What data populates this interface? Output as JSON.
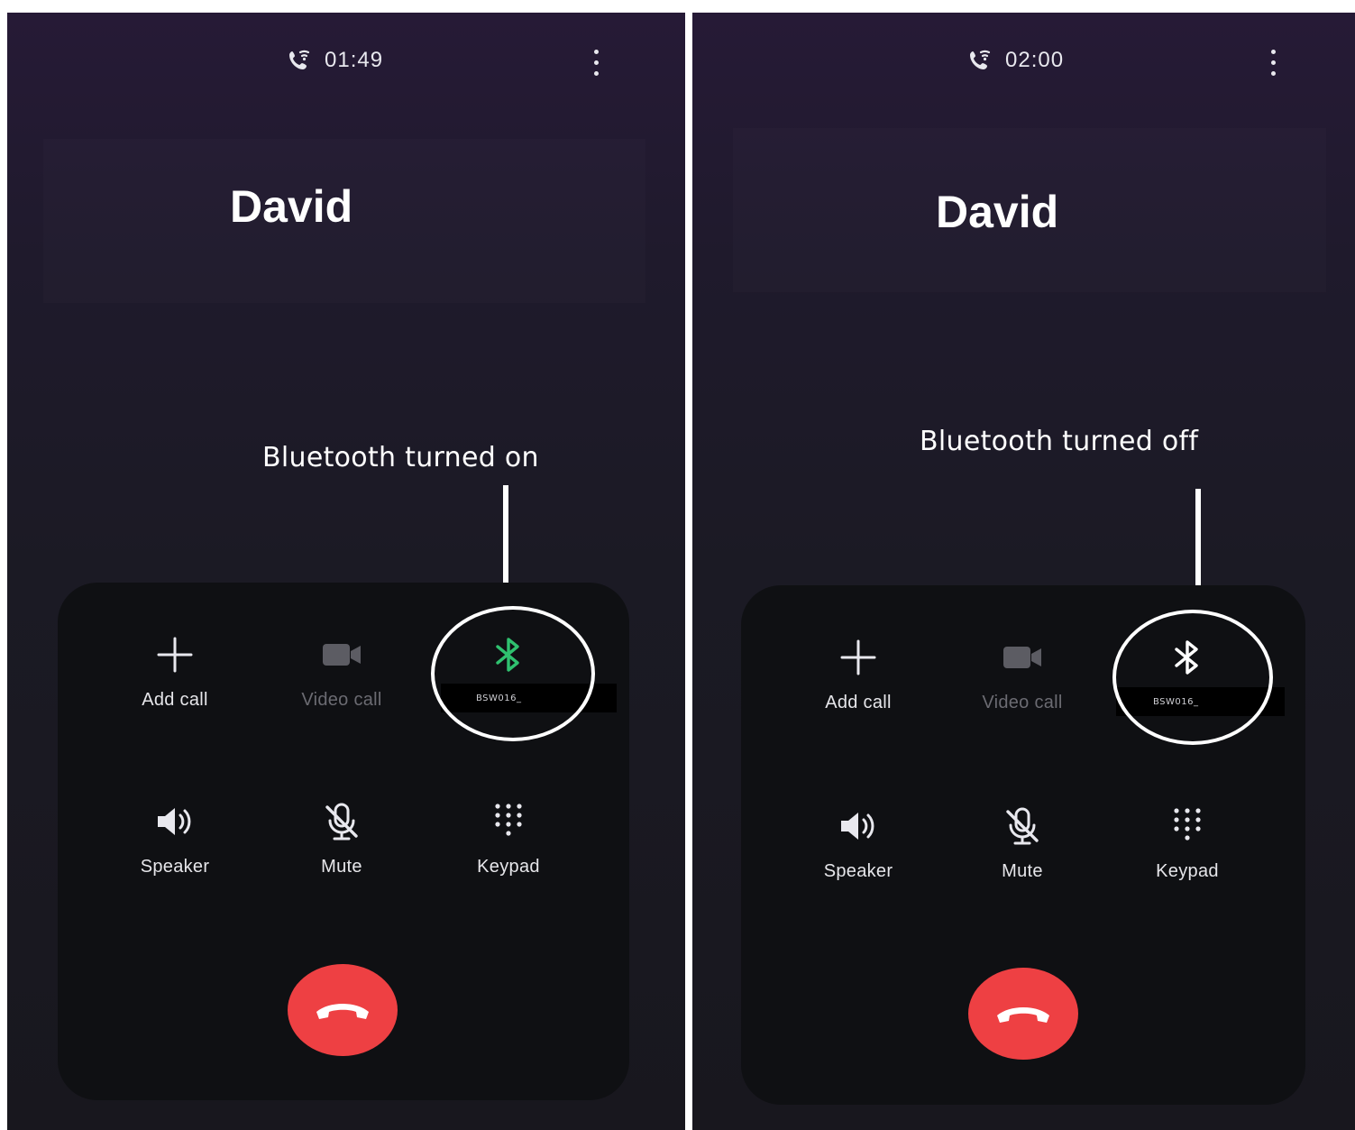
{
  "colors": {
    "end_call": "#ee4043",
    "bluetooth_on": "#2fc16f",
    "bluetooth_off": "#ffffff",
    "disabled_label": "#6b6b72"
  },
  "icons": [
    "wifi-call-icon",
    "kebab-menu-icon",
    "plus-icon",
    "video-camera-icon",
    "bluetooth-icon",
    "speaker-icon",
    "mic-off-icon",
    "keypad-icon",
    "end-call-icon"
  ],
  "left": {
    "timer": "01:49",
    "contact_name": "David",
    "annotation": "Bluetooth turned on",
    "bluetooth_device": "BSW016_",
    "bluetooth_state": "on",
    "controls": {
      "add_call": "Add call",
      "video_call": "Video call",
      "speaker": "Speaker",
      "mute": "Mute",
      "keypad": "Keypad"
    }
  },
  "right": {
    "timer": "02:00",
    "contact_name": "David",
    "annotation": "Bluetooth turned off",
    "bluetooth_device": "BSW016_",
    "bluetooth_state": "off",
    "controls": {
      "add_call": "Add call",
      "video_call": "Video call",
      "speaker": "Speaker",
      "mute": "Mute",
      "keypad": "Keypad"
    }
  }
}
